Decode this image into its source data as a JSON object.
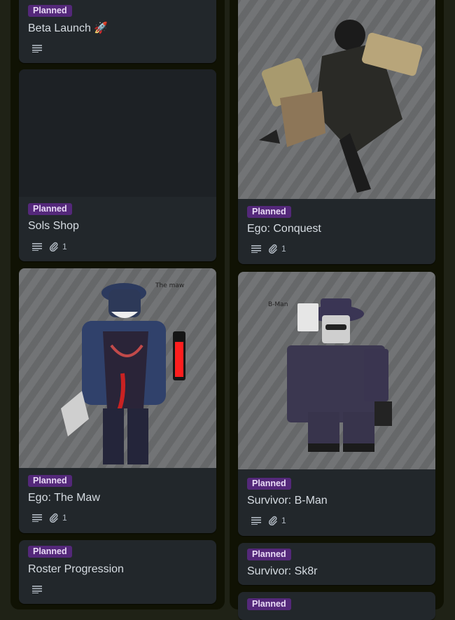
{
  "board": {
    "colors": {
      "label_planned": "#54287a",
      "card_bg": "#22272b",
      "column_bg": "#101204"
    }
  },
  "cards": {
    "beta_launch": {
      "label": "Planned",
      "title": "Beta Launch 🚀"
    },
    "sols_shop": {
      "label": "Planned",
      "title": "Sols Shop",
      "attachments": "1"
    },
    "ego_the_maw": {
      "label": "Planned",
      "title": "Ego: The Maw",
      "attachments": "1",
      "cover_caption": "The maw"
    },
    "roster_progression": {
      "label": "Planned",
      "title": "Roster Progression"
    },
    "ego_conquest": {
      "label": "Planned",
      "title": "Ego: Conquest",
      "attachments": "1"
    },
    "survivor_bman": {
      "label": "Planned",
      "title": "Survivor: B-Man",
      "attachments": "1",
      "cover_caption": "B-Man"
    },
    "survivor_sk8r": {
      "label": "Planned",
      "title": "Survivor: Sk8r"
    },
    "next_card": {
      "label": "Planned"
    }
  },
  "icons": {
    "description": "description-icon",
    "attachment": "paperclip-icon"
  }
}
